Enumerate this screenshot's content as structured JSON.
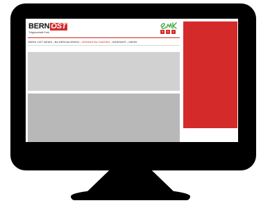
{
  "site": {
    "logo": {
      "part1": "BERN",
      "part2": "OST",
      "subtitle": "Trägerschaft Emk"
    },
    "social": [
      {
        "icon": "facebook-icon",
        "glyph": "f"
      },
      {
        "icon": "twitter-icon",
        "glyph": "t"
      },
      {
        "icon": "rss-icon",
        "glyph": "r"
      }
    ],
    "nav": {
      "items": [
        {
          "label": "BERN OST NEWS",
          "active": false
        },
        {
          "label": "BILDERGALERIEN",
          "active": false
        },
        {
          "label": "VERANSTALTUNGEN",
          "active": true
        },
        {
          "label": "INSERATE",
          "active": false
        },
        {
          "label": "MEHR",
          "active": false
        }
      ],
      "separator": "|"
    }
  },
  "colors": {
    "accent": "#d22b2b",
    "panel": "#d42a2a",
    "placeholder_light": "#d1d1d1",
    "placeholder_dark": "#b8b8b8",
    "monitor": "#000000",
    "emk_green": "#3aa53a"
  }
}
